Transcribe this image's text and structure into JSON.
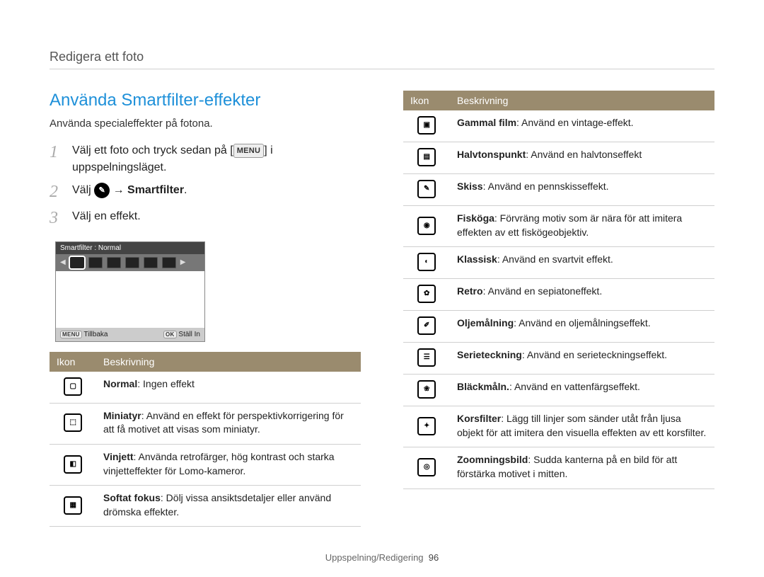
{
  "breadcrumb": "Redigera ett foto",
  "heading": "Använda Smartfilter-effekter",
  "intro": "Använda specialeffekter på fotona.",
  "steps": {
    "s1_pre": "Välj ett foto och tryck sedan på [",
    "s1_menu": "MENU",
    "s1_post": "] i uppspelningsläget.",
    "s2_pre": "Välj ",
    "s2_arrow": " → ",
    "s2_bold": "Smartfilter",
    "s2_period": ".",
    "s3": "Välj en effekt.",
    "n1": "1",
    "n2": "2",
    "n3": "3"
  },
  "device": {
    "header": "Smartfilter : Normal",
    "back_key": "MENU",
    "back_label": "Tillbaka",
    "ok_key": "OK",
    "ok_label": "Ställ In"
  },
  "table_headers": {
    "icon": "Ikon",
    "desc": "Beskrivning"
  },
  "effects_left": [
    {
      "icon": "▢",
      "name": "Normal",
      "desc": ": Ingen effekt"
    },
    {
      "icon": "⬚",
      "name": "Miniatyr",
      "desc": ": Använd en effekt för perspektivkorrigering för att få motivet att visas som miniatyr."
    },
    {
      "icon": "◧",
      "name": "Vinjett",
      "desc": ": Använda retrofärger, hög kontrast och starka vinjetteffekter för Lomo-kameror."
    },
    {
      "icon": "▦",
      "name": "Softat fokus",
      "desc": ": Dölj vissa ansiktsdetaljer eller använd drömska effekter."
    }
  ],
  "effects_right": [
    {
      "icon": "▣",
      "name": "Gammal film",
      "desc": ": Använd en vintage-effekt."
    },
    {
      "icon": "▤",
      "name": "Halvtonspunkt",
      "desc": ": Använd en halvtonseffekt"
    },
    {
      "icon": "✎",
      "name": "Skiss",
      "desc": ": Använd en pennskisseffekt."
    },
    {
      "icon": "◉",
      "name": "Fisköga",
      "desc": ": Förvräng motiv som är nära för att imitera effekten av ett fiskögeobjektiv."
    },
    {
      "icon": "◐",
      "name": "Klassisk",
      "desc": ": Använd en svartvit effekt."
    },
    {
      "icon": "✿",
      "name": "Retro",
      "desc": ": Använd en sepiatoneffekt."
    },
    {
      "icon": "✐",
      "name": "Oljemålning",
      "desc": ": Använd en oljemålningseffekt."
    },
    {
      "icon": "☰",
      "name": "Serieteckning",
      "desc": ": Använd en serieteckningseffekt."
    },
    {
      "icon": "❀",
      "name": "Bläckmåln.",
      "desc": ": Använd en vattenfärgseffekt."
    },
    {
      "icon": "✦",
      "name": "Korsfilter",
      "desc": ": Lägg till linjer som sänder utåt från ljusa objekt för att imitera den visuella effekten av ett korsfilter."
    },
    {
      "icon": "◎",
      "name": "Zoomningsbild",
      "desc": ": Sudda kanterna på en bild för att förstärka motivet i mitten."
    }
  ],
  "footer": {
    "section": "Uppspelning/Redigering",
    "page": "96"
  }
}
